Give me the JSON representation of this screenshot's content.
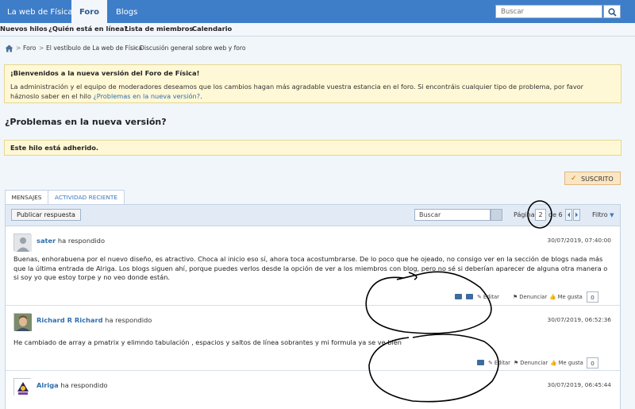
{
  "topbar": {
    "tabs": [
      {
        "label": "La web de Física"
      },
      {
        "label": "Foro"
      },
      {
        "label": "Blogs"
      }
    ],
    "search_placeholder": "Buscar"
  },
  "subnav": {
    "items": [
      "Nuevos hilos",
      "¿Quién está en línea?",
      "Lista de miembros",
      "Calendario"
    ]
  },
  "breadcrumb": {
    "items": [
      "Foro",
      "El vestíbulo de La web de Física",
      "Discusión general sobre web y foro"
    ],
    "separator": ">"
  },
  "notice": {
    "title": "¡Bienvenidos a la nueva versión del Foro de Física!",
    "body": "La administración y el equipo de moderadores deseamos que los cambios hagan más agradable vuestra estancia en el foro. Si encontráis cualquier tipo de problema, por favor háznoslo saber en el hilo ",
    "link": "¿Problemas en la nueva versión?",
    "end": "."
  },
  "thread": {
    "title": "¿Problemas en la nueva versión?",
    "sticky_label": "Este hilo está adherido.",
    "subscribed_label": "SUSCRITO"
  },
  "tabs": {
    "messages": "MENSAJES",
    "recent": "ACTIVIDAD RECIENTE"
  },
  "toolbar": {
    "reply_label": "Publicar respuesta",
    "search_placeholder": "Buscar",
    "page_label": "Página",
    "page_value": "2",
    "page_of": "de 6",
    "filter_label": "Filtro"
  },
  "posts": [
    {
      "author": "sater",
      "action": " ha respondido",
      "date": "30/07/2019, 07:40:00",
      "body": "Buenas, enhorabuena por el nuevo diseño, es atractivo. Choca al inicio eso sí, ahora toca acostumbrarse. De lo poco que he ojeado, no consigo ver en la sección de blogs nada más que la última entrada de Alriga. Los blogs siguen ahí, porque puedes verlos desde la opción de ver a los miembros con blog, pero no sé si deberían aparecer de alguna otra manera o si soy yo que estoy torpe y no veo donde están.",
      "edit": "Editar",
      "report": "Denunciar",
      "like": "Me gusta",
      "likes": "0"
    },
    {
      "author": "Richard R Richard",
      "action": " ha respondido",
      "date": "30/07/2019, 06:52:36",
      "body": "He cambiado de array a pmatrix y elimndo tabulación , espacios y saltos de línea sobrantes y mi formula ya se ve bien",
      "edit": "Editar",
      "report": "Denunciar",
      "like": "Me gusta",
      "likes": "0"
    },
    {
      "author": "Alriga",
      "action": " ha respondido",
      "date": "30/07/2019, 06:45:44"
    }
  ]
}
